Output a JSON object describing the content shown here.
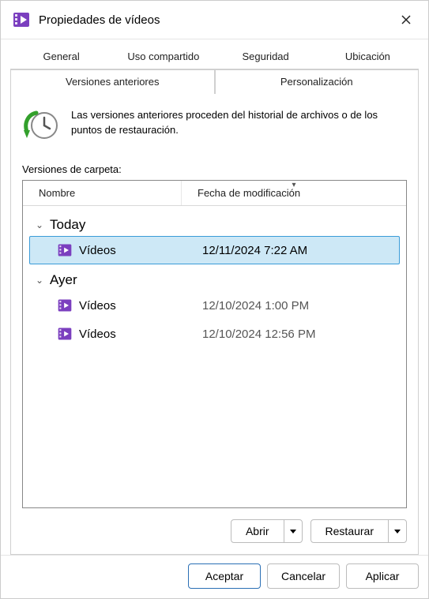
{
  "window": {
    "title": "Propiedades de vídeos"
  },
  "tabs_row1": {
    "general": "General",
    "sharing": "Uso compartido",
    "security": "Seguridad",
    "location": "Ubicación"
  },
  "tabs_row2": {
    "prev_versions": "Versiones anteriores",
    "personalization": "Personalización"
  },
  "info": {
    "text": "Las versiones anteriores proceden del historial de archivos o de los puntos de restauración."
  },
  "section_label": "Versiones de carpeta:",
  "columns": {
    "name": "Nombre",
    "modified": "Fecha de modificación"
  },
  "groups": [
    {
      "label": "Today",
      "items": [
        {
          "name": "Vídeos",
          "date": "12/11/2024 7:22 AM",
          "selected": true
        }
      ]
    },
    {
      "label": "Ayer",
      "items": [
        {
          "name": "Vídeos",
          "date": "12/10/2024 1:00 PM",
          "selected": false
        },
        {
          "name": "Vídeos",
          "date": "12/10/2024 12:56 PM",
          "selected": false
        }
      ]
    }
  ],
  "actions": {
    "open": "Abrir",
    "restore": "Restaurar"
  },
  "buttons": {
    "ok": "Aceptar",
    "cancel": "Cancelar",
    "apply": "Aplicar"
  }
}
